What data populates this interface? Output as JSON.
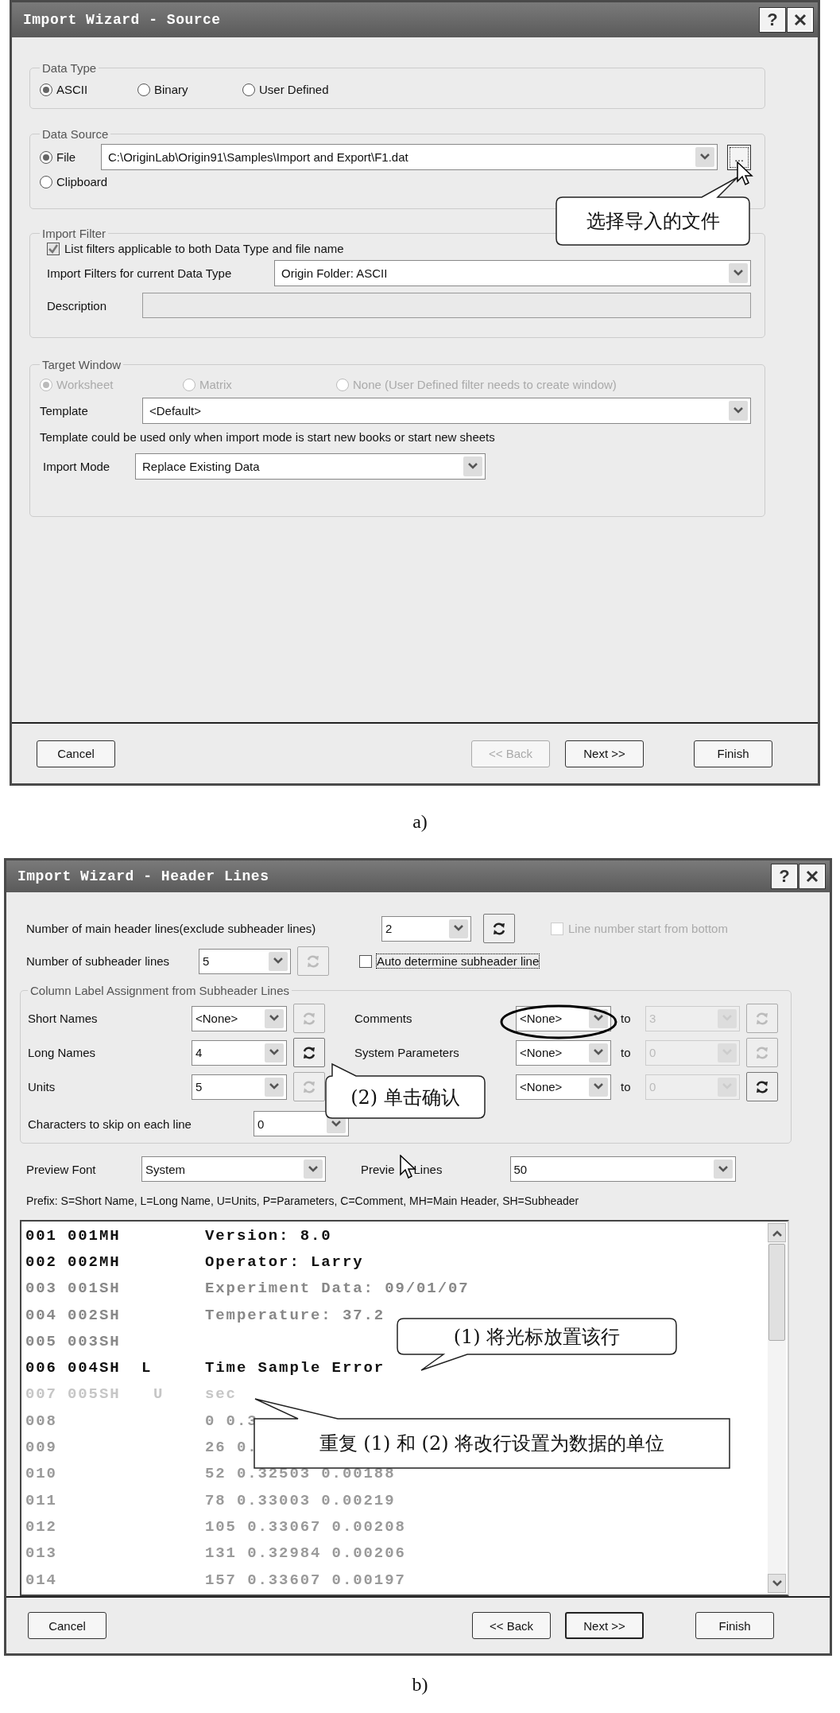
{
  "dialog_a": {
    "title": "Import Wizard - Source",
    "help_button": "?",
    "data_type": {
      "legend": "Data Type",
      "options": [
        {
          "label": "ASCII",
          "selected": true
        },
        {
          "label": "Binary",
          "selected": false
        },
        {
          "label": "User Defined",
          "selected": false
        }
      ]
    },
    "data_source": {
      "legend": "Data Source",
      "options": [
        {
          "label": "File",
          "selected": true
        },
        {
          "label": "Clipboard",
          "selected": false
        }
      ],
      "file_path": "C:\\OriginLab\\Origin91\\Samples\\Import and Export\\F1.dat",
      "browse_button": "..."
    },
    "import_filter": {
      "legend": "Import Filter",
      "checkbox": {
        "label": "List filters applicable to both Data Type and file name",
        "checked": true
      },
      "filter_label": "Import Filters for current Data Type",
      "filter_value": "Origin Folder: ASCII",
      "description_label": "Description"
    },
    "target_window": {
      "legend": "Target Window",
      "options": [
        {
          "label": "Worksheet",
          "selected": true,
          "disabled": true
        },
        {
          "label": "Matrix",
          "selected": false,
          "disabled": true
        },
        {
          "label": "None (User Defined filter needs to create window)",
          "selected": false,
          "disabled": true
        }
      ],
      "template_label": "Template",
      "template_value": "<Default>",
      "note": "Template could be used only when import mode is start new books or start new sheets",
      "import_mode_label": "Import Mode",
      "import_mode_value": "Replace Existing Data"
    },
    "callout": "选择导入的文件",
    "buttons": [
      {
        "label": "Cancel",
        "disabled": false
      },
      {
        "label": "<< Back",
        "disabled": true
      },
      {
        "label": "Next >>",
        "disabled": false
      },
      {
        "label": "Finish",
        "disabled": false
      }
    ]
  },
  "caption_a": "a)",
  "dialog_b": {
    "title": "Import Wizard - Header Lines",
    "help_button": "?",
    "main_header": {
      "label": "Number of main header lines(exclude subheader lines)",
      "value": "2",
      "refresh_enabled": true
    },
    "line_number_checkbox": {
      "label": "Line number start from bottom",
      "checked": false,
      "disabled": true
    },
    "subheader": {
      "label": "Number of subheader lines",
      "value": "5",
      "refresh_enabled": false
    },
    "auto_checkbox": {
      "label": "Auto determine subheader line",
      "checked": false,
      "focused": true
    },
    "assignment": {
      "legend": "Column Label Assignment from Subheader Lines",
      "rows": [
        {
          "label": "Short Names",
          "value": "<None>",
          "refresh_enabled": false,
          "right_label": "Comments",
          "right_value": "<None>",
          "to": "to",
          "to_value": "3",
          "to_disabled": true,
          "right_refresh_enabled": false
        },
        {
          "label": "Long Names",
          "value": "4",
          "refresh_enabled": true,
          "right_label": "System Parameters",
          "right_value": "<None>",
          "to": "to",
          "to_value": "0",
          "to_disabled": true,
          "right_refresh_enabled": false
        },
        {
          "label": "Units",
          "value": "5",
          "refresh_enabled": false,
          "right_value": "<None>",
          "to": "to",
          "to_value": "0",
          "to_disabled": true,
          "right_refresh_enabled": true
        }
      ],
      "skip_label": "Characters to skip on each line",
      "skip_value": "0"
    },
    "preview_font": {
      "label": "Preview Font",
      "value": "System"
    },
    "preview_lines": {
      "label_start": "Previe",
      "label_end": "Lines",
      "value": "50"
    },
    "prefix": "Prefix:  S=Short Name, L=Long Name, U=Units, P=Parameters, C=Comment, MH=Main Header, SH=Subheader",
    "preview_rows": [
      {
        "line": "001",
        "tag": "001MH",
        "text": "Version: 8.0",
        "kind": "header"
      },
      {
        "line": "002",
        "tag": "002MH",
        "text": "Operator: Larry",
        "kind": "header"
      },
      {
        "line": "003",
        "tag": "001SH",
        "text": "Experiment Data: 09/01/07",
        "kind": "sub"
      },
      {
        "line": "004",
        "tag": "002SH",
        "text": "Temperature: 37.2",
        "kind": "sub"
      },
      {
        "line": "005",
        "tag": "003SH",
        "kind": "sub"
      },
      {
        "line": "006",
        "tag": "004SH",
        "label": "L",
        "text": "Time Sample Error",
        "kind": "header"
      },
      {
        "line": "007",
        "tag": "005SH",
        "label": "U",
        "text": "sec",
        "kind": "faint"
      },
      {
        "line": "008",
        "text": "0 0.3",
        "kind": "data"
      },
      {
        "line": "009",
        "text": "26 0.",
        "kind": "data"
      },
      {
        "line": "010",
        "text": "52 0.32503 0.00188",
        "kind": "data"
      },
      {
        "line": "011",
        "text": "78 0.33003 0.00219",
        "kind": "data"
      },
      {
        "line": "012",
        "text": "105 0.33067 0.00208",
        "kind": "data"
      },
      {
        "line": "013",
        "text": "131 0.32984 0.00206",
        "kind": "data"
      },
      {
        "line": "014",
        "text": "157 0.33607 0.00197",
        "kind": "data"
      }
    ],
    "callouts": [
      "(2) 单击确认",
      "(1) 将光标放置该行",
      "重复 (1) 和 (2) 将改行设置为数据的单位"
    ],
    "buttons": [
      {
        "label": "Cancel",
        "disabled": false,
        "default": false
      },
      {
        "label": "<< Back",
        "disabled": false,
        "default": false
      },
      {
        "label": "Next >>",
        "disabled": false,
        "default": true
      },
      {
        "label": "Finish",
        "disabled": false,
        "default": false
      }
    ]
  },
  "caption_b": "b)"
}
